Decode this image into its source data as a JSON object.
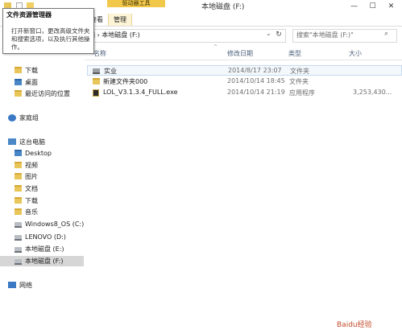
{
  "window": {
    "title": "本地磁盘 (F:)",
    "context_group": "驱动器工具",
    "minimize": "—",
    "maximize": "☐",
    "close": "✕"
  },
  "ribbon": {
    "tabs": [
      "查看",
      "管理"
    ]
  },
  "tooltip": {
    "title": "文件资源管理器",
    "body": "打开新窗口，更改高级文件夹和搜索选项，以及执行其他操作。"
  },
  "address": {
    "path": "脑 › 本地磁盘 (F:)",
    "search_placeholder": "搜索\"本地磁盘 (F:)\""
  },
  "columns": [
    "名称",
    "修改日期",
    "类型",
    "大小"
  ],
  "files": [
    {
      "name": "实业",
      "date": "2014/8/17 23:07",
      "type": "文件夹",
      "size": "",
      "icon": "drive-folder-icon"
    },
    {
      "name": "新建文件夹000",
      "date": "2014/10/14 18:45",
      "type": "文件夹",
      "size": "",
      "icon": "folder-icon"
    },
    {
      "name": "LOL_V3.1.3.4_FULL.exe",
      "date": "2014/10/14 21:19",
      "type": "应用程序",
      "size": "3,253,430...",
      "icon": "exe-icon"
    }
  ],
  "sidebar": {
    "favorites": [
      {
        "label": "下载",
        "icon": "folder-icon"
      },
      {
        "label": "桌面",
        "icon": "folder-icon"
      },
      {
        "label": "最近访问的位置",
        "icon": "folder-icon"
      }
    ],
    "homegroup": "家庭组",
    "thispc": "这台电脑",
    "pc_items": [
      {
        "label": "Desktop",
        "icon": "folder-icon"
      },
      {
        "label": "视频",
        "icon": "folder-icon"
      },
      {
        "label": "图片",
        "icon": "folder-icon"
      },
      {
        "label": "文档",
        "icon": "folder-icon"
      },
      {
        "label": "下载",
        "icon": "folder-icon"
      },
      {
        "label": "音乐",
        "icon": "folder-icon"
      },
      {
        "label": "Windows8_OS (C:)",
        "icon": "drive-icon"
      },
      {
        "label": "LENOVO (D:)",
        "icon": "drive-icon"
      },
      {
        "label": "本地磁盘 (E:)",
        "icon": "drive-icon"
      },
      {
        "label": "本地磁盘 (F:)",
        "icon": "drive-icon"
      }
    ],
    "network": "网络"
  },
  "watermark": "Baidu经验",
  "colors": {
    "context_band": "#f1c84a",
    "selection": "#d6d6d6",
    "header_text": "#4c607a"
  }
}
